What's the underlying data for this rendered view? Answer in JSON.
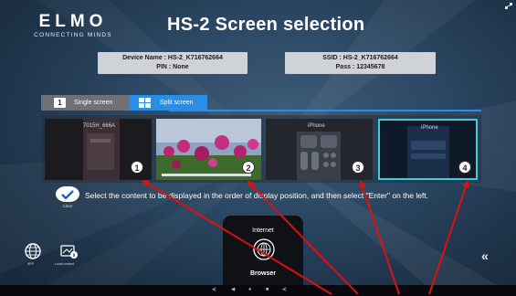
{
  "header": {
    "logo_main": "ELMO",
    "logo_sub": "CONNECTING MINDS",
    "title": "HS-2 Screen selection",
    "status_icon": "network-status-icon"
  },
  "info": {
    "device_name": "Device Name : HS-2_K716762664",
    "pin": "PIN : None",
    "ssid": "SSID : HS-2_K716762664",
    "pass": "Pass : 12345678"
  },
  "tabs": [
    {
      "label": "Single screen",
      "num": "1",
      "selected": false
    },
    {
      "label": "Split screen",
      "icon": "split-grid-icon",
      "selected": true
    }
  ],
  "screens": [
    {
      "label": "7015H_666A",
      "number": "1"
    },
    {
      "label": "",
      "number": "2"
    },
    {
      "label": "iPhone",
      "number": "3"
    },
    {
      "label": "iPhone",
      "number": "4",
      "selected": true
    }
  ],
  "instruction": {
    "clear_label": "Clear",
    "text": "Select the content to be displayed in the order of display position, and then select \"Enter\" on the left."
  },
  "bottom": {
    "left_items": [
      {
        "label": "APP",
        "icon": "globe-grid-icon"
      },
      {
        "label": "Local content",
        "icon": "folder-file-icon"
      }
    ],
    "card_title": "Internet",
    "card_label": "Browser",
    "card_icon": "globe-icon",
    "collapse_icon": "double-chevron-left-icon",
    "collapse_symbol": "«"
  },
  "navbar": {
    "items": [
      "◂)",
      "◀",
      "●",
      "■",
      "◂)"
    ]
  },
  "colors": {
    "accent": "#2a8ee6",
    "highlight": "#3dcde0",
    "annotation": "#e01010"
  }
}
